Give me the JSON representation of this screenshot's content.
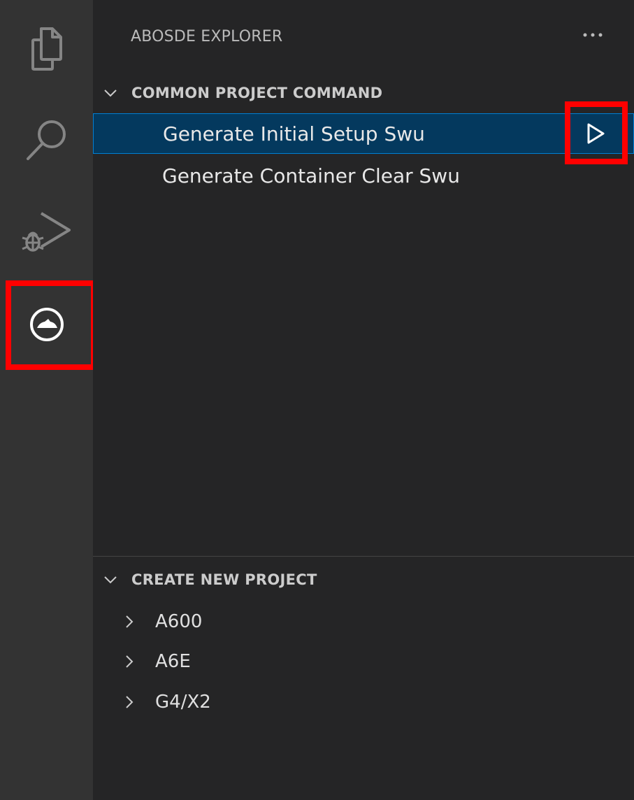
{
  "activity_bar": {
    "items": [
      {
        "name": "explorer",
        "icon": "files-icon"
      },
      {
        "name": "search",
        "icon": "search-icon"
      },
      {
        "name": "run-debug",
        "icon": "run-debug-icon"
      },
      {
        "name": "abosde",
        "icon": "abosde-icon"
      }
    ],
    "highlighted": "abosde"
  },
  "sidebar": {
    "title": "ABOSDE EXPLORER",
    "more_actions_icon": "ellipsis-icon"
  },
  "common_project_command": {
    "header": "COMMON PROJECT COMMAND",
    "expanded": true,
    "items": [
      {
        "label": "Generate Initial Setup Swu",
        "selected": true,
        "action_icon": "play-icon"
      },
      {
        "label": "Generate Container Clear Swu",
        "selected": false
      }
    ]
  },
  "create_new_project": {
    "header": "CREATE NEW PROJECT",
    "expanded": true,
    "items": [
      {
        "label": "A600"
      },
      {
        "label": "A6E"
      },
      {
        "label": "G4/X2"
      }
    ]
  },
  "colors": {
    "activity_bar_bg": "#333333",
    "sidebar_bg": "#252526",
    "selection_bg": "#04395e",
    "selection_border": "#007fd4",
    "highlight_red": "#ff0000",
    "icon_color": "#858585"
  }
}
